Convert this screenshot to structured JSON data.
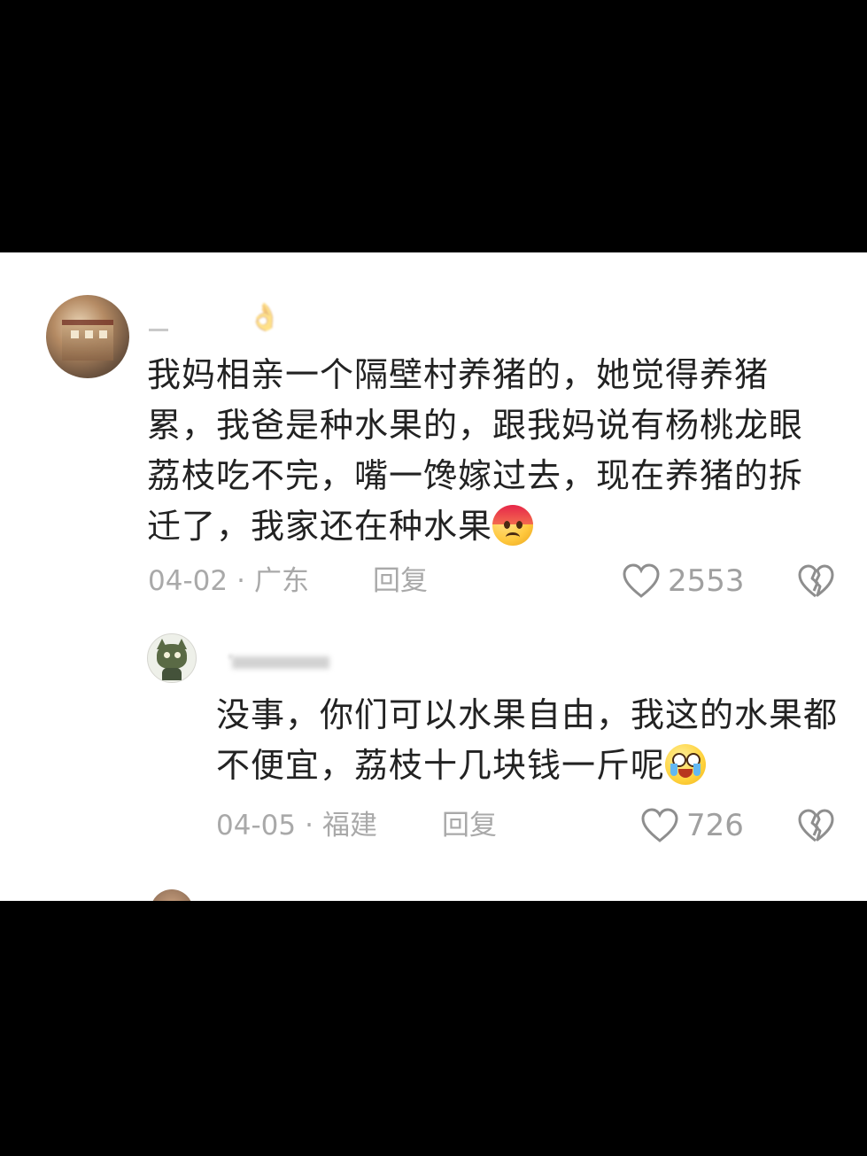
{
  "comments": [
    {
      "username": "",
      "text": "我妈相亲一个隔壁村养猪的，她觉得养猪累，我爸是种水果的，跟我妈说有杨桃龙眼荔枝吃不完，嘴一馋嫁过去，现在养猪的拆迁了，我家还在种水果",
      "emoji": "worried-face-icon",
      "date": "04-02",
      "location": "广东",
      "reply_label": "回复",
      "likes": "2553"
    },
    {
      "username": "·",
      "text": "没事，你们可以水果自由，我这的水果都不便宜，荔枝十几块钱一斤呢",
      "emoji": "crying-laughing-icon",
      "date": "04-05",
      "location": "福建",
      "reply_label": "回复",
      "likes": "726"
    }
  ],
  "separator": "·",
  "colors": {
    "background": "#ffffff",
    "frame": "#000000",
    "text": "#222222",
    "meta": "#a9a9a9"
  }
}
